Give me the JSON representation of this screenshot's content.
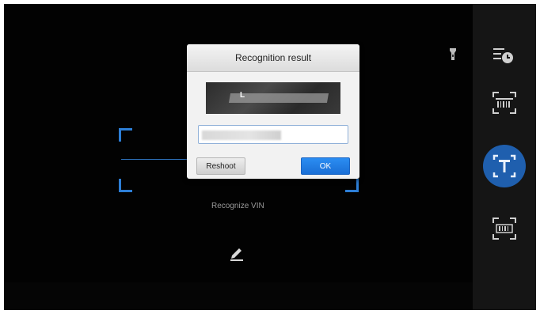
{
  "dialog": {
    "title": "Recognition result",
    "recognized_text": "",
    "reshoot_label": "Reshoot",
    "ok_label": "OK"
  },
  "scanner": {
    "hint": "Recognize VIN"
  },
  "side_panel": {
    "buttons": [
      "history-icon",
      "barcode-icon",
      "text-recognition-icon",
      "qr-scan-icon"
    ],
    "active_button": "text-recognition-icon"
  },
  "colors": {
    "accent": "#1f5fae",
    "frame": "#2d7ed6",
    "ok_button": "#1a6fd6"
  }
}
